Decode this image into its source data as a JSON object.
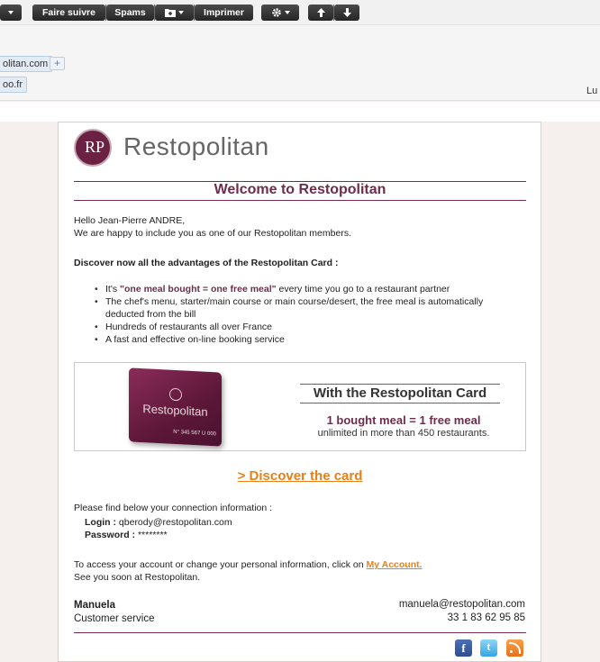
{
  "toolbar": {
    "follow_label": "Faire suivre",
    "spam_label": "Spams",
    "print_label": "Imprimer"
  },
  "header": {
    "recipient_chip": "olitan.com",
    "sender_chip": "oo.fr",
    "date_partial": "Lu"
  },
  "email": {
    "brand": "Restopolitan",
    "logo_monogram": "RP",
    "welcome_title": "Welcome to Restopolitan",
    "greeting": "Hello Jean-Pierre ANDRE,",
    "intro": "We are happy to include you as one of our Restopolitan members.",
    "advantages_heading": "Discover now all the advantages of the Restopolitan Card :",
    "bullet1_prefix": "It's ",
    "bullet1_highlight": "\"one meal bought = one free meal\"",
    "bullet1_suffix": " every time you go to a restaurant partner",
    "bullet2": "The chef's menu, starter/main course or main course/desert, the free meal is automatically deducted from the bill",
    "bullet3": "Hundreds of restaurants all over France",
    "bullet4": "A fast and effective on-line booking service",
    "card_brand": "Restopolitan",
    "card_number": "N° 345 567 U 000",
    "promo_title": "With the Restopolitan Card",
    "promo_offer": "1 bought meal = 1 free meal",
    "promo_detail": "unlimited in more than 450 restaurants.",
    "discover_link": "> Discover the card",
    "connection_intro": "Please find below your connection information :",
    "login_label": "Login :",
    "login_value": "qberody@restopolitan.com",
    "password_label": "Password :",
    "password_value": "********",
    "account_text": "To access your account or change your personal information, click on ",
    "account_link": "My Account.",
    "see_you": "See you soon at Restopolitan.",
    "sig_name": "Manuela",
    "sig_role": "Customer service",
    "sig_email": "manuela@restopolitan.com",
    "sig_phone": "33 1 83 62 95 85",
    "social_fb": "f",
    "social_tw": "t"
  },
  "icons": {
    "gear": "gear-icon",
    "up": "arrow-up-icon",
    "down": "arrow-down-icon",
    "folder": "folder-icon"
  },
  "colors": {
    "brand_purple": "#6e2c4c",
    "link_orange": "#e8801a"
  }
}
